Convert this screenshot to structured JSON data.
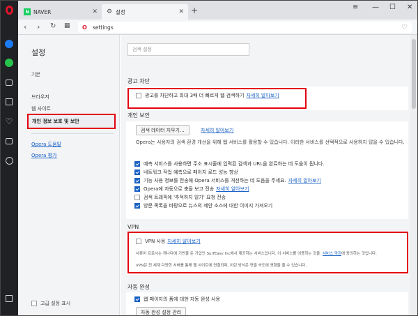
{
  "tabs": [
    {
      "label": "NAVER",
      "favicon": "N"
    },
    {
      "label": "설정",
      "favicon": "⚙"
    }
  ],
  "address": {
    "url": "settings"
  },
  "sidebar": {
    "title": "설정",
    "items": [
      "기본",
      "브라우저",
      "웹 사이트",
      "개인 정보 보호 및 보안"
    ],
    "links": [
      "Opera 도움말",
      "Opera 평가"
    ],
    "advanced_label": "고급 설정 표시"
  },
  "search": {
    "placeholder": "검색 설정"
  },
  "adblock": {
    "heading": "광고 차단",
    "option": "광고를 차단하고 최대 3배 더 빠르게 웹 검색하기",
    "link": "자세히 알아보기"
  },
  "privacy": {
    "heading": "개인 보안",
    "clear_button": "검색 데이터 지우기...",
    "learn_more": "자세히 알아보기",
    "description": "Opera는 사용자의 검색 환경 개선을 위해 웹 서비스를 활용할 수 있습니다. 이러한 서비스를 선택적으로 사용하지 않을 수 있습니다.",
    "options": [
      {
        "label": "예측 서비스를 사용하면 주소 표시줄에 입력된 검색과 URL을 완료하는 데 도움이 됩니다.",
        "checked": true,
        "link": ""
      },
      {
        "label": "네트워크 작업 예측으로 페이지 로드 성능 향상",
        "checked": true,
        "link": ""
      },
      {
        "label": "기능 사용 정보를 전송해 Opera 서비스를 개선하는 데 도움을 주세요.",
        "checked": true,
        "link": "자세히 알아보기"
      },
      {
        "label": "Opera에 자동으로 충돌 보고 전송",
        "checked": true,
        "link": "자세히 알아보기"
      },
      {
        "label": "검색 트래픽에 '추적하지 않기' 요청 전송",
        "checked": false,
        "link": ""
      },
      {
        "label": "방문 목록을 바탕으로 뉴스의 제안 소스에 대한 이미지 가져오기",
        "checked": true,
        "link": ""
      }
    ]
  },
  "vpn": {
    "heading": "VPN",
    "option": "VPN 사용",
    "link": "자세히 알아보기",
    "note1": "사류어 프로시는 캐나다에 기반을 둔 기업인 SurfEasy Inc에서 제공하는 서비스입니다. 이 서비스를 이용하는 것을",
    "note1_link": "서비스 약관",
    "note1_end": "에 동의하는 것입니다.",
    "note2": "VPN은 전 세계 다양한 서버를 통해 웹 사이트에 연결되며, 이런 방식은 연결 속도에 영향을 줄 수 있습니다."
  },
  "autofill": {
    "heading": "자동 완성",
    "option": "웹 페이지의 폼에 대한 자동 완성 사용",
    "button": "자동 완성 설정 관리"
  }
}
